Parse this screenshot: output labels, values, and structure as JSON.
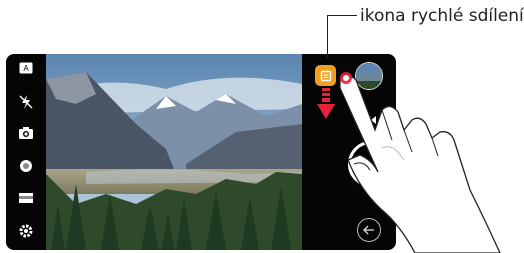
{
  "callout": {
    "label": "ikona rychlé sdílení"
  },
  "left_bar": {
    "mode_badge": "A",
    "icons": [
      "auto-mode-icon",
      "flash-off-icon",
      "switch-camera-icon",
      "filter-icon",
      "aspect-ratio-icon",
      "settings-icon"
    ]
  },
  "right_bar": {
    "icons": [
      "quick-share-icon",
      "gallery-thumbnail",
      "video-record-icon",
      "shutter-button",
      "back-icon"
    ]
  },
  "colors": {
    "share_orange": "#f0a020",
    "arrow_red": "#e8213a",
    "background": "#050505"
  }
}
